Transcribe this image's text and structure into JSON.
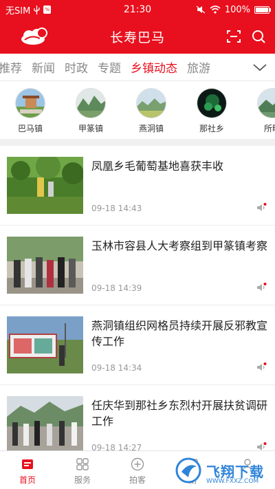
{
  "status_bar": {
    "carrier": "无SIM",
    "time": "21:30",
    "battery": "100%",
    "battery_level": 1.0
  },
  "header": {
    "title": "长寿巴马",
    "logo": "cloud-logo",
    "icons": [
      "scan-icon",
      "search-icon"
    ]
  },
  "tabs": {
    "items": [
      "推荐",
      "新闻",
      "时政",
      "专题",
      "乡镇动态",
      "旅游"
    ],
    "active": "乡镇动态",
    "more_icon": "chevron-down-icon"
  },
  "towns": [
    {
      "name": "巴马镇"
    },
    {
      "name": "甲篆镇"
    },
    {
      "name": "燕洞镇"
    },
    {
      "name": "那社乡"
    },
    {
      "name": "所略"
    }
  ],
  "news": [
    {
      "title": "凤凰乡毛葡萄基地喜获丰收",
      "time": "09-18 14:43"
    },
    {
      "title": "玉林市容县人大考察组到甲篆镇考察",
      "time": "09-18 14:39"
    },
    {
      "title": "燕洞镇组织网格员持续开展反邪教宣传工作",
      "time": "09-18 14:34"
    },
    {
      "title": "任庆华到那社乡东烈村开展扶贫调研工作",
      "time": "09-18 14:27"
    }
  ],
  "bottom_nav": [
    {
      "label": "首页",
      "icon": "home-icon",
      "active": true
    },
    {
      "label": "服务",
      "icon": "grid-icon",
      "active": false
    },
    {
      "label": "拍客",
      "icon": "plus-circle-icon",
      "active": false
    },
    {
      "label": "副",
      "icon": "partial-icon",
      "active": false
    },
    {
      "label": "",
      "icon": "profile-icon",
      "active": false
    }
  ],
  "watermark": {
    "text": "飞翔下载",
    "url": "WWW.FXXZ.COM"
  },
  "colors": {
    "brand": "#e8101e",
    "watermark": "#2f84d8"
  }
}
